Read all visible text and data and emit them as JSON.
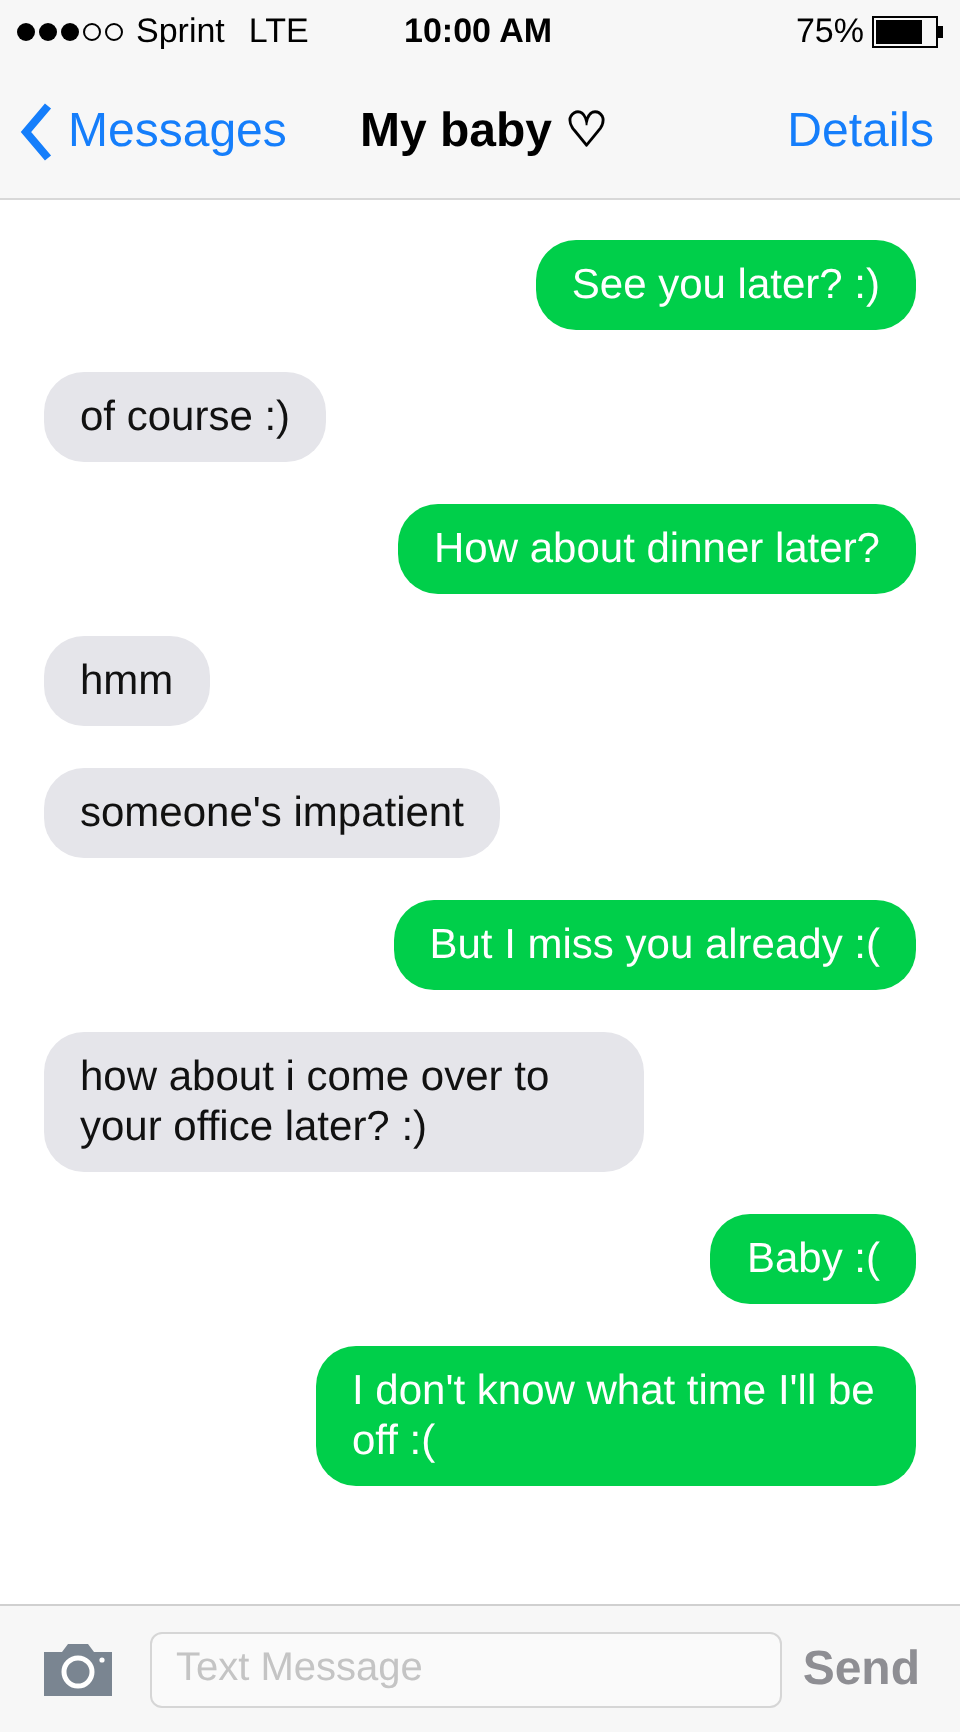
{
  "status_bar": {
    "carrier": "Sprint",
    "network": "LTE",
    "time": "10:00 AM",
    "battery": "75%"
  },
  "nav_bar": {
    "back": "Messages",
    "title": "My baby ♡",
    "action": "Details"
  },
  "messages": [
    {
      "kind": "sent",
      "text": "See you later? :)"
    },
    {
      "kind": "received",
      "text": "of course :)"
    },
    {
      "kind": "sent",
      "text": "How about dinner later?"
    },
    {
      "kind": "received",
      "text": "hmm"
    },
    {
      "kind": "received",
      "text": "someone's impatient"
    },
    {
      "kind": "sent",
      "text": "But I miss you already :("
    },
    {
      "kind": "received",
      "text": "how about i come over to your office later? :)"
    },
    {
      "kind": "sent",
      "text": "Baby :("
    },
    {
      "kind": "sent",
      "text": "I don't know what time I'll be off :("
    }
  ],
  "composer": {
    "placeholder": "Text Message",
    "send": "Send"
  }
}
